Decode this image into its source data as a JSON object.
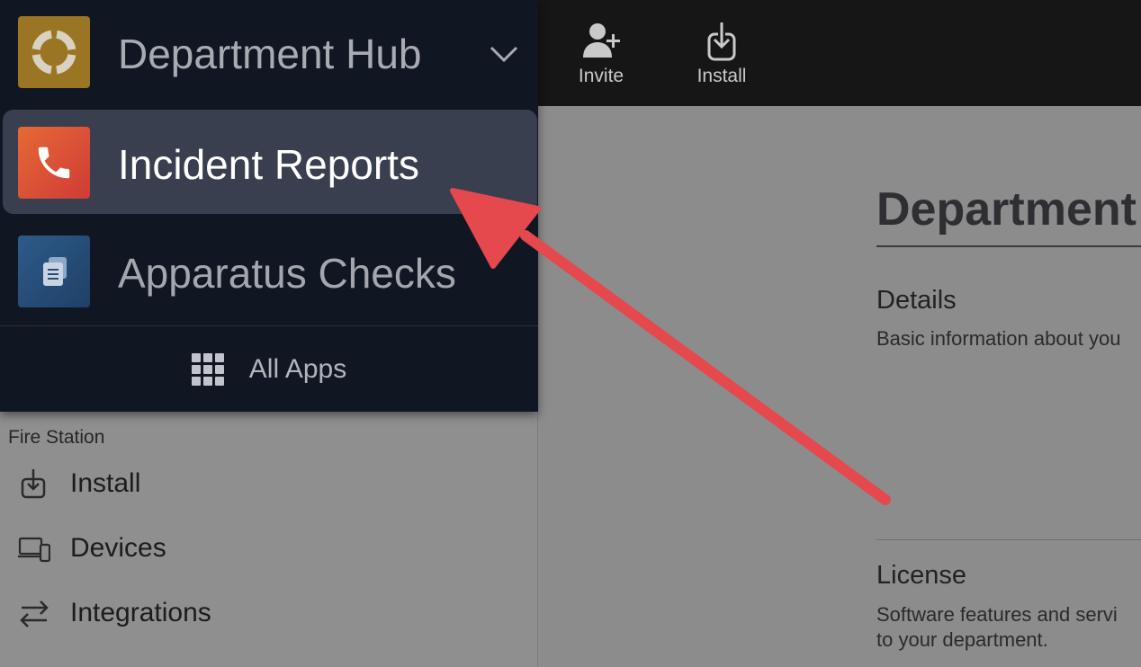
{
  "topbar": {
    "buttons": [
      {
        "label": "Invite",
        "icon": "add-user-icon"
      },
      {
        "label": "Install",
        "icon": "install-icon"
      }
    ]
  },
  "app_switcher": {
    "current_app": {
      "label": "Department Hub",
      "icon": "lifebuoy-icon",
      "color": "#9a7524"
    },
    "items": [
      {
        "label": "Incident Reports",
        "icon": "phone-icon",
        "selected": true,
        "color": "#e0552f"
      },
      {
        "label": "Apparatus Checks",
        "icon": "clipboard-icon",
        "selected": false,
        "color": "#2b5585"
      }
    ],
    "all_apps_label": "All Apps"
  },
  "sidebar": {
    "section_title": "Fire Station",
    "items": [
      {
        "label": "Install",
        "icon": "install-icon"
      },
      {
        "label": "Devices",
        "icon": "devices-icon"
      },
      {
        "label": "Integrations",
        "icon": "swap-arrows-icon"
      }
    ]
  },
  "main": {
    "title": "Department",
    "details_heading": "Details",
    "details_text": "Basic information about you",
    "license_heading": "License",
    "license_text_line1": "Software features and servi",
    "license_text_line2": "to your department."
  },
  "annotation": {
    "type": "arrow",
    "color": "#e5484d"
  }
}
